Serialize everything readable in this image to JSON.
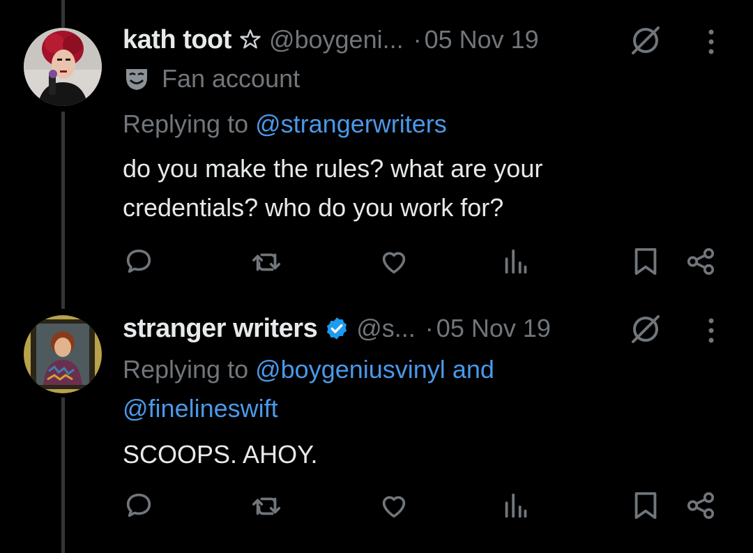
{
  "tweets": [
    {
      "name": "kath toot",
      "handle": "@boygeni...",
      "dot": "·",
      "date": "05 Nov 19",
      "label": "Fan account",
      "replying_prefix": "Replying to ",
      "replying_to": "@strangerwriters",
      "text": [
        "do you make the rules? what are your",
        "credentials? who do you work for?"
      ]
    },
    {
      "name": "stranger writers",
      "handle": "@s...",
      "dot": "·",
      "date": "05 Nov 19",
      "replying_prefix": "Replying to ",
      "replying_to_1": "@boygeniusvinyl",
      "replying_and": " and",
      "replying_to_2": "@finelineswift",
      "text": [
        "SCOOPS. AHOY."
      ]
    }
  ],
  "icons": {
    "reply": "reply-icon",
    "retweet": "retweet-icon",
    "like": "heart-icon",
    "views": "views-icon",
    "bookmark": "bookmark-icon",
    "share": "share-icon",
    "more": "more-icon",
    "grok": "grok-icon",
    "verified": "verified-badge-icon",
    "star": "star-icon",
    "mask": "fan-mask-icon"
  },
  "colors": {
    "background": "#000000",
    "text": "#e7e9ea",
    "muted": "#71767b",
    "link": "#4a99e9",
    "verified": "#1d9bf0"
  }
}
